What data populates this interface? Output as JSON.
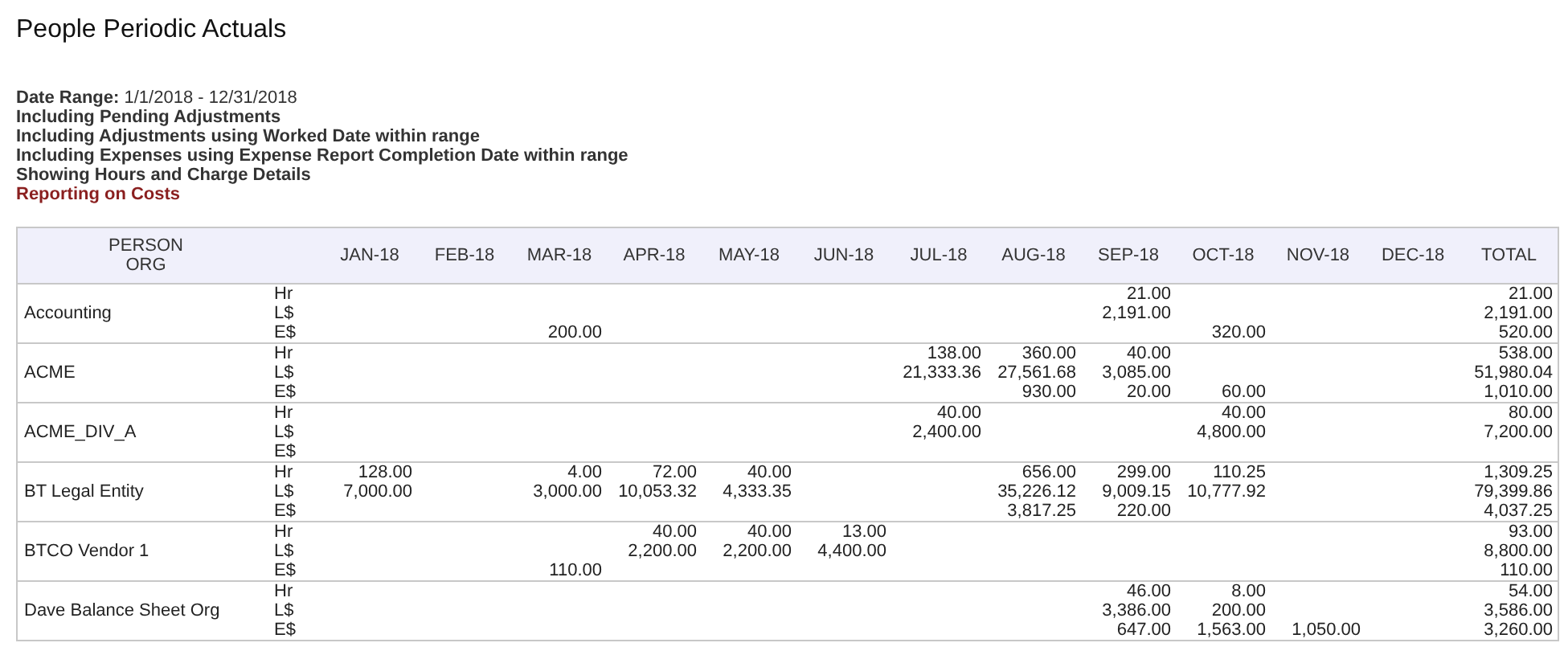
{
  "title": "People Periodic Actuals",
  "criteria": [
    {
      "text": "**Date Range:** 1/1/2018 - 12/31/2018",
      "kind": "plain"
    },
    {
      "text": "Including Pending Adjustments",
      "kind": "plain"
    },
    {
      "text": "Including Adjustments using Worked Date within range",
      "kind": "plain"
    },
    {
      "text": "Including Expenses using Expense Report Completion Date within range",
      "kind": "plain"
    },
    {
      "text": "Showing Hours and Charge Details",
      "kind": "plain"
    },
    {
      "text": "Reporting on Costs",
      "kind": "highlight"
    }
  ],
  "table": {
    "header": {
      "person": "PERSON",
      "org": "ORG"
    },
    "columns": [
      "JAN-18",
      "FEB-18",
      "MAR-18",
      "APR-18",
      "MAY-18",
      "JUN-18",
      "JUL-18",
      "AUG-18",
      "SEP-18",
      "OCT-18",
      "NOV-18",
      "DEC-18",
      "TOTAL"
    ],
    "rows": [
      {
        "org": "Accounting",
        "measures": [
          {
            "label": "Hr",
            "values": {
              "sep": "21.00",
              "total": "21.00"
            }
          },
          {
            "label": "L$",
            "values": {
              "sep": "2,191.00",
              "total": "2,191.00"
            }
          },
          {
            "label": "E$",
            "values": {
              "mar": "200.00",
              "oct": "320.00",
              "total": "520.00"
            }
          }
        ]
      },
      {
        "org": "ACME",
        "measures": [
          {
            "label": "Hr",
            "values": {
              "jul": "138.00",
              "aug": "360.00",
              "sep": "40.00",
              "total": "538.00"
            }
          },
          {
            "label": "L$",
            "values": {
              "jul": "21,333.36",
              "aug": "27,561.68",
              "sep": "3,085.00",
              "total": "51,980.04"
            }
          },
          {
            "label": "E$",
            "values": {
              "aug": "930.00",
              "sep": "20.00",
              "oct": "60.00",
              "total": "1,010.00"
            }
          }
        ]
      },
      {
        "org": "ACME_DIV_A",
        "measures": [
          {
            "label": "Hr",
            "values": {
              "jul": "40.00",
              "oct": "40.00",
              "total": "80.00"
            }
          },
          {
            "label": "L$",
            "values": {
              "jul": "2,400.00",
              "oct": "4,800.00",
              "total": "7,200.00"
            }
          },
          {
            "label": "E$"
          }
        ]
      },
      {
        "org": "BT Legal Entity",
        "measures": [
          {
            "label": "Hr",
            "values": {
              "jan": "128.00",
              "mar": "4.00",
              "apr": "72.00",
              "may": "40.00",
              "aug": "656.00",
              "sep": "299.00",
              "oct": "110.25",
              "total": "1,309.25"
            }
          },
          {
            "label": "L$",
            "values": {
              "jan": "7,000.00",
              "mar": "3,000.00",
              "apr": "10,053.32",
              "may": "4,333.35",
              "aug": "35,226.12",
              "sep": "9,009.15",
              "oct": "10,777.92",
              "total": "79,399.86"
            }
          },
          {
            "label": "E$",
            "values": {
              "aug": "3,817.25",
              "sep": "220.00",
              "total": "4,037.25"
            }
          }
        ]
      },
      {
        "org": "BTCO Vendor 1",
        "measures": [
          {
            "label": "Hr",
            "values": {
              "apr": "40.00",
              "may": "40.00",
              "jun": "13.00",
              "total": "93.00"
            }
          },
          {
            "label": "L$",
            "values": {
              "apr": "2,200.00",
              "may": "2,200.00",
              "jun": "4,400.00",
              "total": "8,800.00"
            }
          },
          {
            "label": "E$",
            "values": {
              "mar": "110.00",
              "total": "110.00"
            }
          }
        ]
      },
      {
        "org": "Dave Balance Sheet Org",
        "measures": [
          {
            "label": "Hr",
            "values": {
              "sep": "46.00",
              "oct": "8.00",
              "total": "54.00"
            }
          },
          {
            "label": "L$",
            "values": {
              "sep": "3,386.00",
              "oct": "200.00",
              "total": "3,586.00"
            }
          },
          {
            "label": "E$",
            "values": {
              "sep": "647.00",
              "oct": "1,563.00",
              "nov": "1,050.00",
              "total": "3,260.00"
            }
          }
        ]
      }
    ]
  }
}
